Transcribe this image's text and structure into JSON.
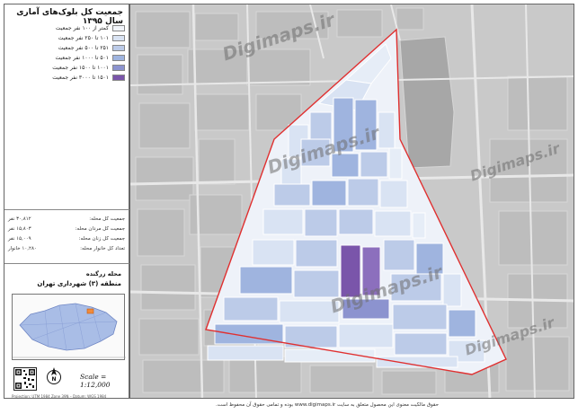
{
  "legend": {
    "title": "جمعیت کل بلوک‌های آماری سال ۱۳۹۵",
    "classes": [
      {
        "label": "کمتر از ۱۰۰ نفر جمعیت",
        "color": "#f2f5fb"
      },
      {
        "label": "۱۰۱ تا ۲۵۰ نفر جمعیت",
        "color": "#d9e3f3"
      },
      {
        "label": "۲۵۱ تا ۵۰۰ نفر جمعیت",
        "color": "#bccbe8"
      },
      {
        "label": "۵۰۱ تا ۱۰۰۰ نفر جمعیت",
        "color": "#9fb4df"
      },
      {
        "label": "۱۰۰۱ تا ۱۵۰۰ نفر جمعیت",
        "color": "#8c93cf"
      },
      {
        "label": "۱۵۰۱ تا ۳۰۰۰ نفر جمعیت",
        "color": "#7a55aa"
      }
    ]
  },
  "stats": [
    {
      "label": "جمعیت کل محله:",
      "value": "۳۰,۸۱۲ نفر"
    },
    {
      "label": "جمعیت کل مردان محله:",
      "value": "۱۵,۸۰۳ نفر"
    },
    {
      "label": "جمعیت کل زنان محله:",
      "value": "۱۵,۰۰۹ نفر"
    },
    {
      "label": "تعداد کل خانوار محله:",
      "value": "۱۰,۲۸۰ خانوار"
    }
  ],
  "area": {
    "neighborhood": "محله زرگنده",
    "district": "منطقه (۳) شهرداری تهران"
  },
  "scale": "Scale = 1:12,000",
  "footer_small": "Projection: UTM 1984 Zone 39N – Datum: WGS 1984",
  "footer_note": "حقوق مالکیت معنوی این محصول متعلق به سایت www.digimaps.ir بوده و تمامی حقوق آن محفوظ است.",
  "watermark": "Digimaps.ir",
  "colors": {
    "boundary": "#e03030",
    "basemap": "#c9c9c9",
    "road": "#e8e8e8"
  }
}
